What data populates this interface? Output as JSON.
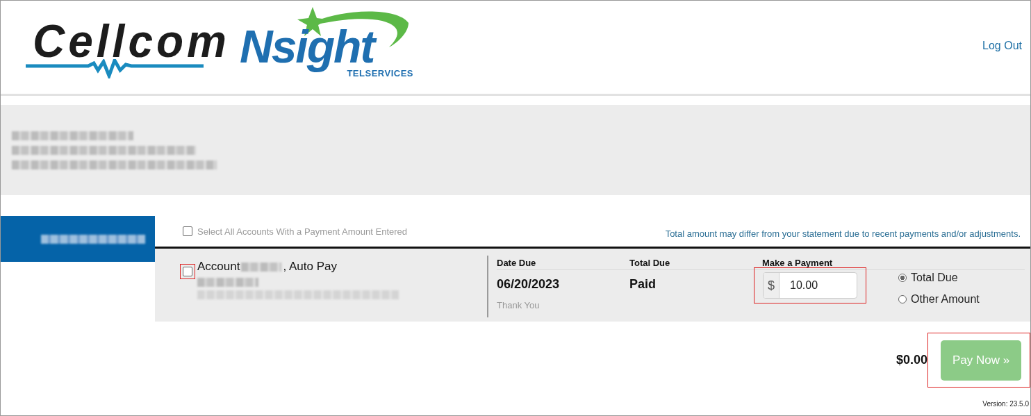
{
  "header": {
    "logo": {
      "brand": "Cellcom",
      "partner": "Nsight",
      "partner_sub": "TELSERVICES"
    },
    "logout": "Log Out"
  },
  "accounts_bar": {
    "select_all": {
      "label": "Select All Accounts With a Payment Amount Entered",
      "checked": false
    },
    "notice": "Total amount may differ from your statement due to recent payments and/or adjustments."
  },
  "accounts": [
    {
      "title_prefix": "Account",
      "title_suffix": ", Auto Pay",
      "checked": false,
      "date_due_label": "Date Due",
      "date_due": "06/20/2023",
      "date_note": "Thank You",
      "total_due_label": "Total Due",
      "total_due": "Paid",
      "payment_label": "Make a Payment",
      "currency": "$",
      "amount": "10.00",
      "options": [
        {
          "label": "Total Due",
          "selected": true
        },
        {
          "label": "Other Amount",
          "selected": false
        }
      ]
    }
  ],
  "total": "$0.00",
  "pay_button": {
    "label": "Pay Now »",
    "disabled": true
  },
  "version": "Version: 23.5.0"
}
